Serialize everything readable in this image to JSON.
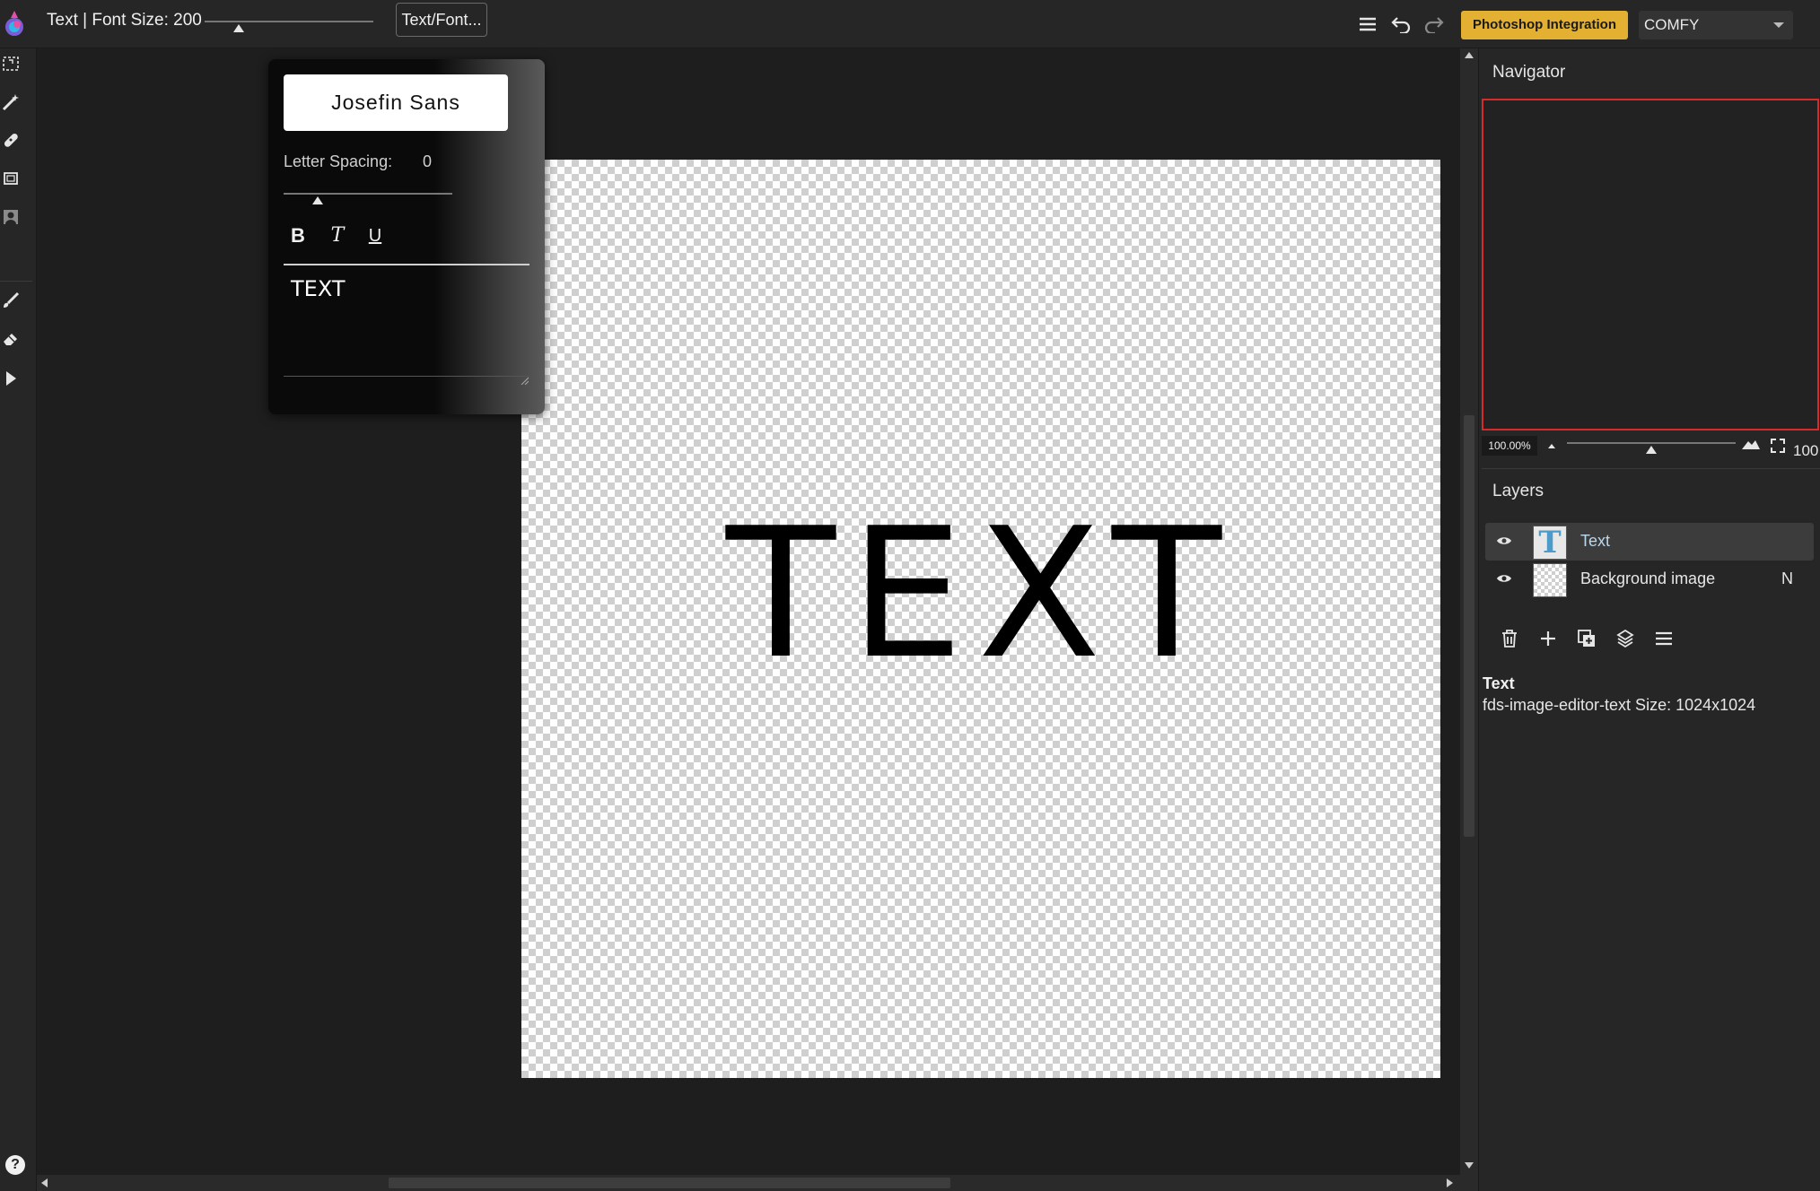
{
  "topbar": {
    "tool_title": "Text | Font Size: 200",
    "font_size_slider_fraction": 0.2,
    "text_font_button": "Text/Font...",
    "photoshop_button": "Photoshop Integration",
    "mode_select": "COMFY",
    "icons": [
      "menu-icon",
      "undo-icon",
      "redo-icon"
    ]
  },
  "left_toolbar": {
    "tools": [
      "rect-select-icon",
      "magic-wand-icon",
      "bandage-icon",
      "crop-icon",
      "person-icon",
      "brush-icon",
      "eraser-icon",
      "pointer-icon"
    ],
    "help": "?"
  },
  "canvas": {
    "text": "TEXT",
    "size": "1024x1024"
  },
  "text_popup": {
    "font_family": "Josefin Sans",
    "letter_spacing_label": "Letter Spacing:",
    "letter_spacing_value": "0",
    "letter_spacing_fraction": 0.2,
    "bold": "B",
    "italic": "T",
    "underline": "U",
    "text_value": "TEXT"
  },
  "navigator": {
    "title": "Navigator",
    "zoom": "100.00%",
    "zoom_slider_fraction": 0.5,
    "zoom_overflow": "100",
    "frame_color": "#d72a2a"
  },
  "layers": {
    "title": "Layers",
    "items": [
      {
        "name": "Text",
        "thumb": "T",
        "selected": true,
        "blend": ""
      },
      {
        "name": "Background image",
        "thumb": "",
        "selected": false,
        "blend": "N"
      }
    ],
    "actions": [
      "trash-icon",
      "add-icon",
      "duplicate-icon",
      "merge-icon",
      "layer-menu-icon"
    ],
    "info_name": "Text",
    "info_detail": "fds-image-editor-text Size: 1024x1024"
  },
  "colors": {
    "accent": "#e3b032",
    "selected_layer_text": "#b9d8ec",
    "background": "#1e1e1e",
    "panel": "#262626"
  }
}
